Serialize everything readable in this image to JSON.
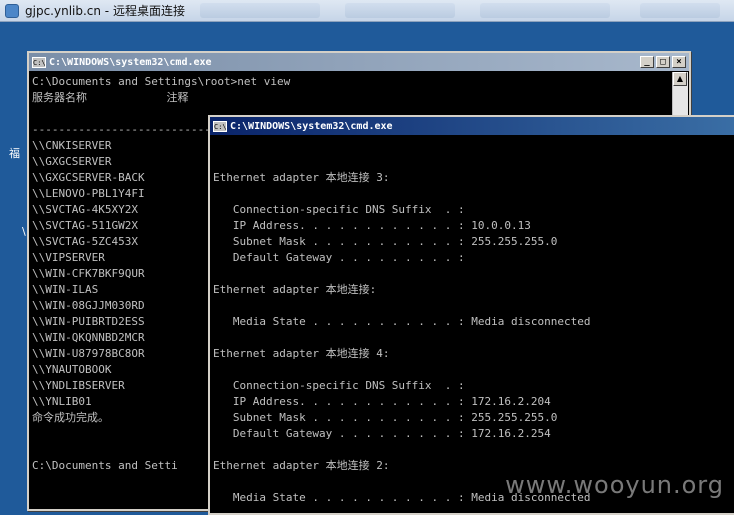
{
  "rdp": {
    "title": "gjpc.ynlib.cn - 远程桌面连接"
  },
  "desktop": {
    "label1": "福",
    "label2": "\\"
  },
  "window1": {
    "title": "C:\\WINDOWS\\system32\\cmd.exe",
    "minimize": "_",
    "maximize": "□",
    "close": "×",
    "lines": [
      "C:\\Documents and Settings\\root>net view",
      "服务器名称            注释",
      "",
      "-------------------------------",
      "\\\\CNKISERVER",
      "\\\\GXGCSERVER",
      "\\\\GXGCSERVER-BACK",
      "\\\\LENOVO-PBL1Y4FI",
      "\\\\SVCTAG-4K5XY2X",
      "\\\\SVCTAG-511GW2X",
      "\\\\SVCTAG-5ZC453X",
      "\\\\VIPSERVER",
      "\\\\WIN-CFK7BKF9QUR",
      "\\\\WIN-ILAS",
      "\\\\WIN-08GJJM030RD",
      "\\\\WIN-PUIBRTD2ESS",
      "\\\\WIN-QKQNNBD2MCR",
      "\\\\WIN-U87978BC8OR",
      "\\\\YNAUTOBOOK",
      "\\\\YNDLIBSERVER",
      "\\\\YNLIB01",
      "命令成功完成。",
      "",
      "",
      "C:\\Documents and Setti"
    ]
  },
  "window2": {
    "title": "C:\\WINDOWS\\system32\\cmd.exe",
    "lines": [
      "",
      "",
      "Ethernet adapter 本地连接 3:",
      "",
      "   Connection-specific DNS Suffix  . :",
      "   IP Address. . . . . . . . . . . . : 10.0.0.13",
      "   Subnet Mask . . . . . . . . . . . : 255.255.255.0",
      "   Default Gateway . . . . . . . . . :",
      "",
      "Ethernet adapter 本地连接:",
      "",
      "   Media State . . . . . . . . . . . : Media disconnected",
      "",
      "Ethernet adapter 本地连接 4:",
      "",
      "   Connection-specific DNS Suffix  . :",
      "   IP Address. . . . . . . . . . . . : 172.16.2.204",
      "   Subnet Mask . . . . . . . . . . . : 255.255.255.0",
      "   Default Gateway . . . . . . . . . : 172.16.2.254",
      "",
      "Ethernet adapter 本地连接 2:",
      "",
      "   Media State . . . . . . . . . . . : Media disconnected"
    ]
  },
  "watermark": "www.wooyun.org",
  "colors": {
    "desktop": "#1f5a9a",
    "active_title": "#0a246a",
    "inactive_title": "#7a8ea8",
    "console_text": "#c0c0c0"
  }
}
